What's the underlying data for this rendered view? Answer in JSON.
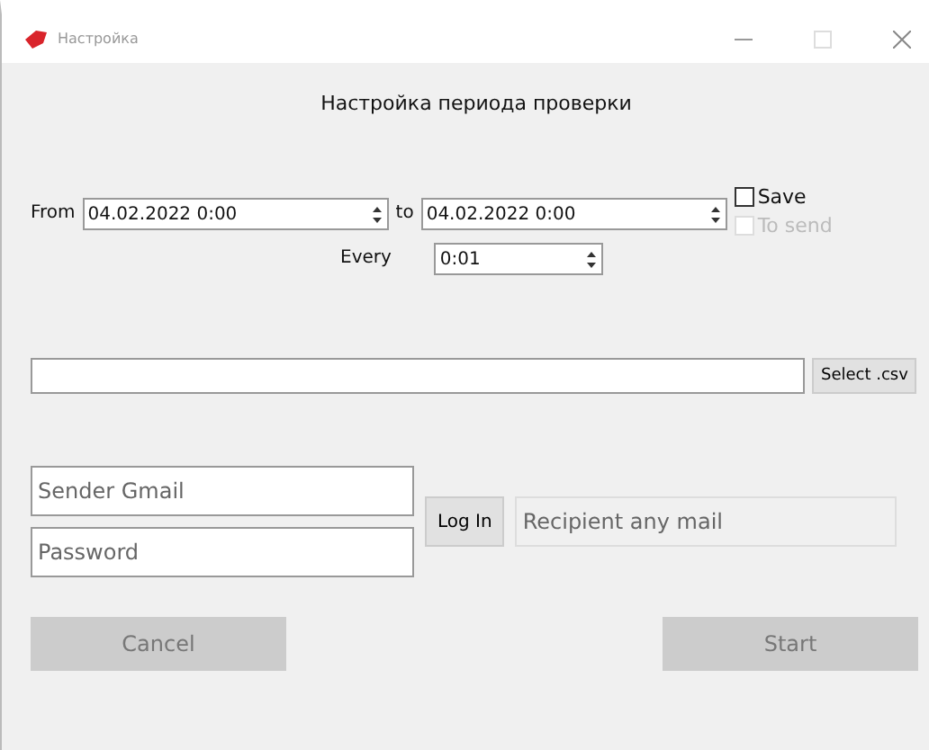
{
  "window": {
    "title": "Настройка"
  },
  "heading": "Настройка периода проверки",
  "period": {
    "from_label": "From",
    "from_value": "04.02.2022 0:00",
    "to_label": "to",
    "to_value": "04.02.2022 0:00",
    "every_label": "Every",
    "every_value": "0:01"
  },
  "options": [
    {
      "label": "Save",
      "checked": false,
      "disabled": false
    },
    {
      "label": "To send",
      "checked": false,
      "disabled": true
    }
  ],
  "csv": {
    "button": "Select .csv"
  },
  "login": {
    "email_placeholder": "Sender Gmail",
    "password_placeholder": "Password",
    "button": "Log In",
    "recipient_placeholder": "Recipient any mail",
    "recipient_disabled": true
  },
  "buttons": [
    {
      "label": "Cancel",
      "disabled": true
    },
    {
      "label": "Start",
      "disabled": true
    }
  ]
}
